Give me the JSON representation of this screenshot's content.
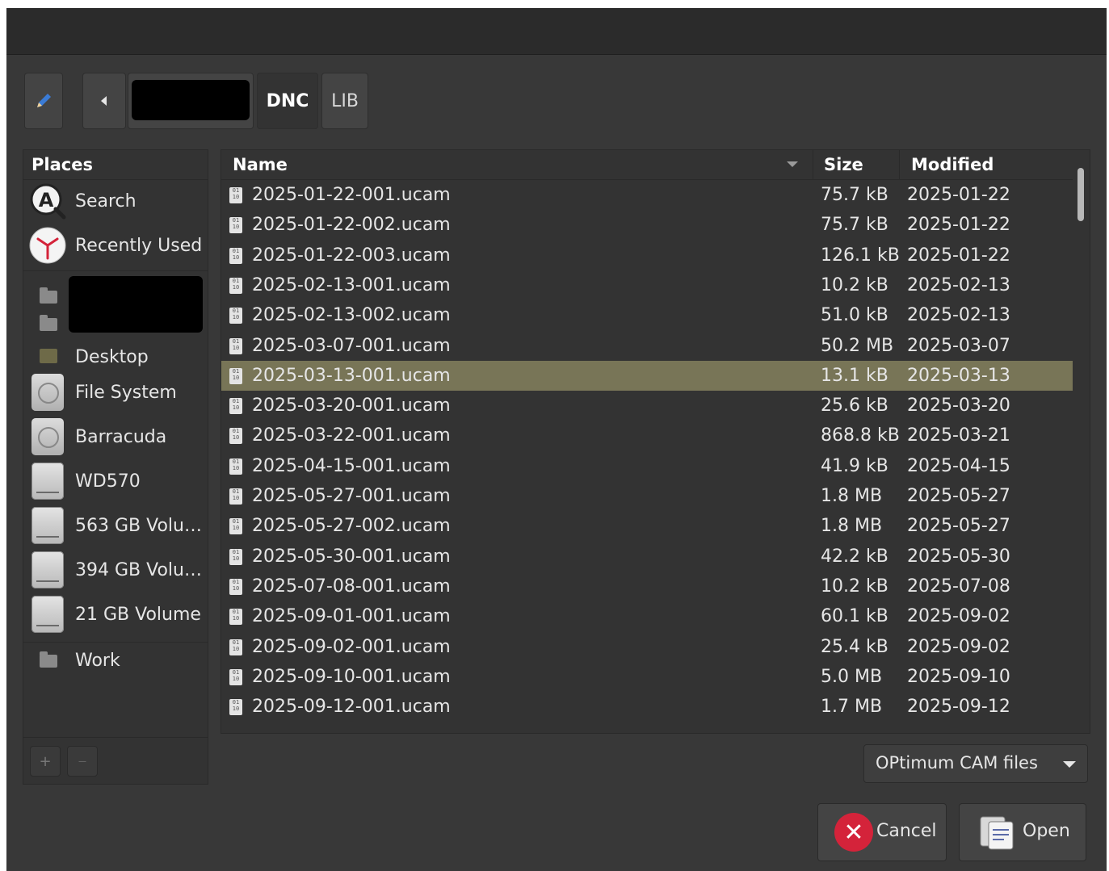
{
  "pathbar": {
    "edit_icon": "pencil-icon",
    "back_icon": "triangle-left-icon",
    "crumbs": [
      "DNC",
      "LIB"
    ]
  },
  "places": {
    "header": "Places",
    "items": [
      {
        "label": "Search",
        "icon": "search-icon"
      },
      {
        "label": "Recently Used",
        "icon": "clock-icon"
      },
      {
        "label": "Desktop",
        "icon": "desktop-folder-icon"
      },
      {
        "label": "File System",
        "icon": "disc-icon"
      },
      {
        "label": "Barracuda",
        "icon": "disc-icon"
      },
      {
        "label": "WD570",
        "icon": "drive-icon"
      },
      {
        "label": "563 GB Volu…",
        "icon": "drive-icon"
      },
      {
        "label": "394 GB Volu…",
        "icon": "drive-icon"
      },
      {
        "label": "21 GB Volume",
        "icon": "drive-icon"
      },
      {
        "label": "Work",
        "icon": "folder-icon"
      }
    ],
    "add_label": "+",
    "remove_label": "—"
  },
  "filelist": {
    "columns": {
      "name": "Name",
      "size": "Size",
      "modified": "Modified"
    },
    "rows": [
      {
        "name": "2025-01-22-001.ucam",
        "size": "75.7 kB",
        "modified": "2025-01-22"
      },
      {
        "name": "2025-01-22-002.ucam",
        "size": "75.7 kB",
        "modified": "2025-01-22"
      },
      {
        "name": "2025-01-22-003.ucam",
        "size": "126.1 kB",
        "modified": "2025-01-22"
      },
      {
        "name": "2025-02-13-001.ucam",
        "size": "10.2 kB",
        "modified": "2025-02-13"
      },
      {
        "name": "2025-02-13-002.ucam",
        "size": "51.0 kB",
        "modified": "2025-02-13"
      },
      {
        "name": "2025-03-07-001.ucam",
        "size": "50.2 MB",
        "modified": "2025-03-07"
      },
      {
        "name": "2025-03-13-001.ucam",
        "size": "13.1 kB",
        "modified": "2025-03-13"
      },
      {
        "name": "2025-03-20-001.ucam",
        "size": "25.6 kB",
        "modified": "2025-03-20"
      },
      {
        "name": "2025-03-22-001.ucam",
        "size": "868.8 kB",
        "modified": "2025-03-21"
      },
      {
        "name": "2025-04-15-001.ucam",
        "size": "41.9 kB",
        "modified": "2025-04-15"
      },
      {
        "name": "2025-05-27-001.ucam",
        "size": "1.8 MB",
        "modified": "2025-05-27"
      },
      {
        "name": "2025-05-27-002.ucam",
        "size": "1.8 MB",
        "modified": "2025-05-27"
      },
      {
        "name": "2025-05-30-001.ucam",
        "size": "42.2 kB",
        "modified": "2025-05-30"
      },
      {
        "name": "2025-07-08-001.ucam",
        "size": "10.2 kB",
        "modified": "2025-07-08"
      },
      {
        "name": "2025-09-01-001.ucam",
        "size": "60.1 kB",
        "modified": "2025-09-02"
      },
      {
        "name": "2025-09-02-001.ucam",
        "size": "25.4 kB",
        "modified": "2025-09-02"
      },
      {
        "name": "2025-09-10-001.ucam",
        "size": "5.0 MB",
        "modified": "2025-09-10"
      },
      {
        "name": "2025-09-12-001.ucam",
        "size": "1.7 MB",
        "modified": "2025-09-12"
      }
    ],
    "selected_index": 6,
    "file_icon": "binary-file-icon"
  },
  "filter": {
    "label": "OPtimum CAM files"
  },
  "actions": {
    "cancel_label": "Cancel",
    "open_label": "Open"
  },
  "colors": {
    "selection": "#787557",
    "cancel_accent": "#d4233a",
    "background": "#383838"
  }
}
